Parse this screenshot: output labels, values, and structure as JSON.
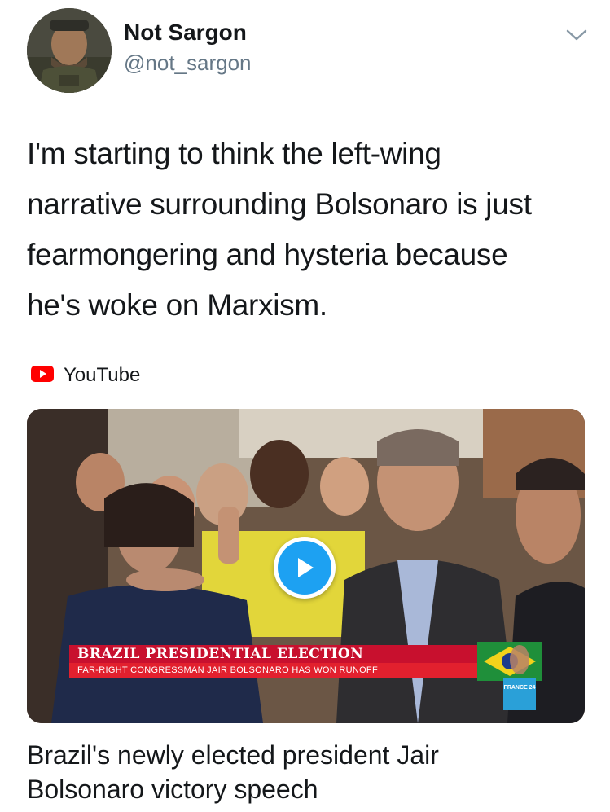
{
  "user": {
    "display_name": "Not Sargon",
    "handle": "@not_sargon"
  },
  "tweet": {
    "text_lines": [
      "I'm starting to think the left-wing",
      "narrative surrounding Bolsonaro is just",
      "fearmongering and hysteria because",
      "he's woke on Marxism."
    ]
  },
  "card": {
    "source_label": "YouTube",
    "headline": "BRAZIL PRESIDENTIAL ELECTION",
    "subheadline": "FAR-RIGHT CONGRESSMAN JAIR BOLSONARO HAS WON RUNOFF",
    "channel_logo_text": "FRANCE 24",
    "title_lines": [
      "Brazil's newly elected president Jair",
      "Bolsonaro victory speech"
    ]
  },
  "icons": {
    "caret": "chevron-down-icon",
    "youtube": "youtube-icon",
    "play": "play-icon"
  },
  "colors": {
    "text": "#14171a",
    "secondary": "#657786",
    "accent": "#1da1f2",
    "youtube_red": "#ff0000",
    "banner_red": "#c8102e"
  }
}
